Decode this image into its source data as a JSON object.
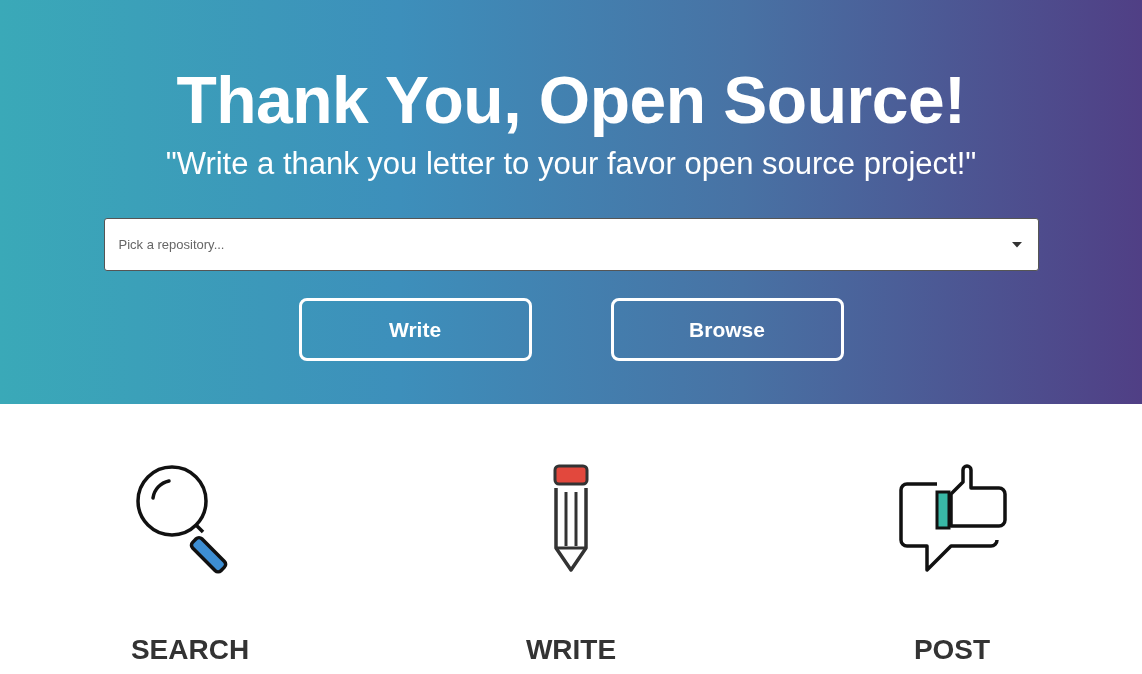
{
  "hero": {
    "title": "Thank You, Open Source!",
    "subtitle": "\"Write a thank you letter to your favor open source project!\"",
    "repository_select": {
      "placeholder": "Pick a repository..."
    },
    "buttons": [
      "Write",
      "Browse"
    ]
  },
  "steps": [
    {
      "kind": "search",
      "label": "SEARCH"
    },
    {
      "kind": "write",
      "label": "WRITE"
    },
    {
      "kind": "post",
      "label": "POST"
    }
  ]
}
